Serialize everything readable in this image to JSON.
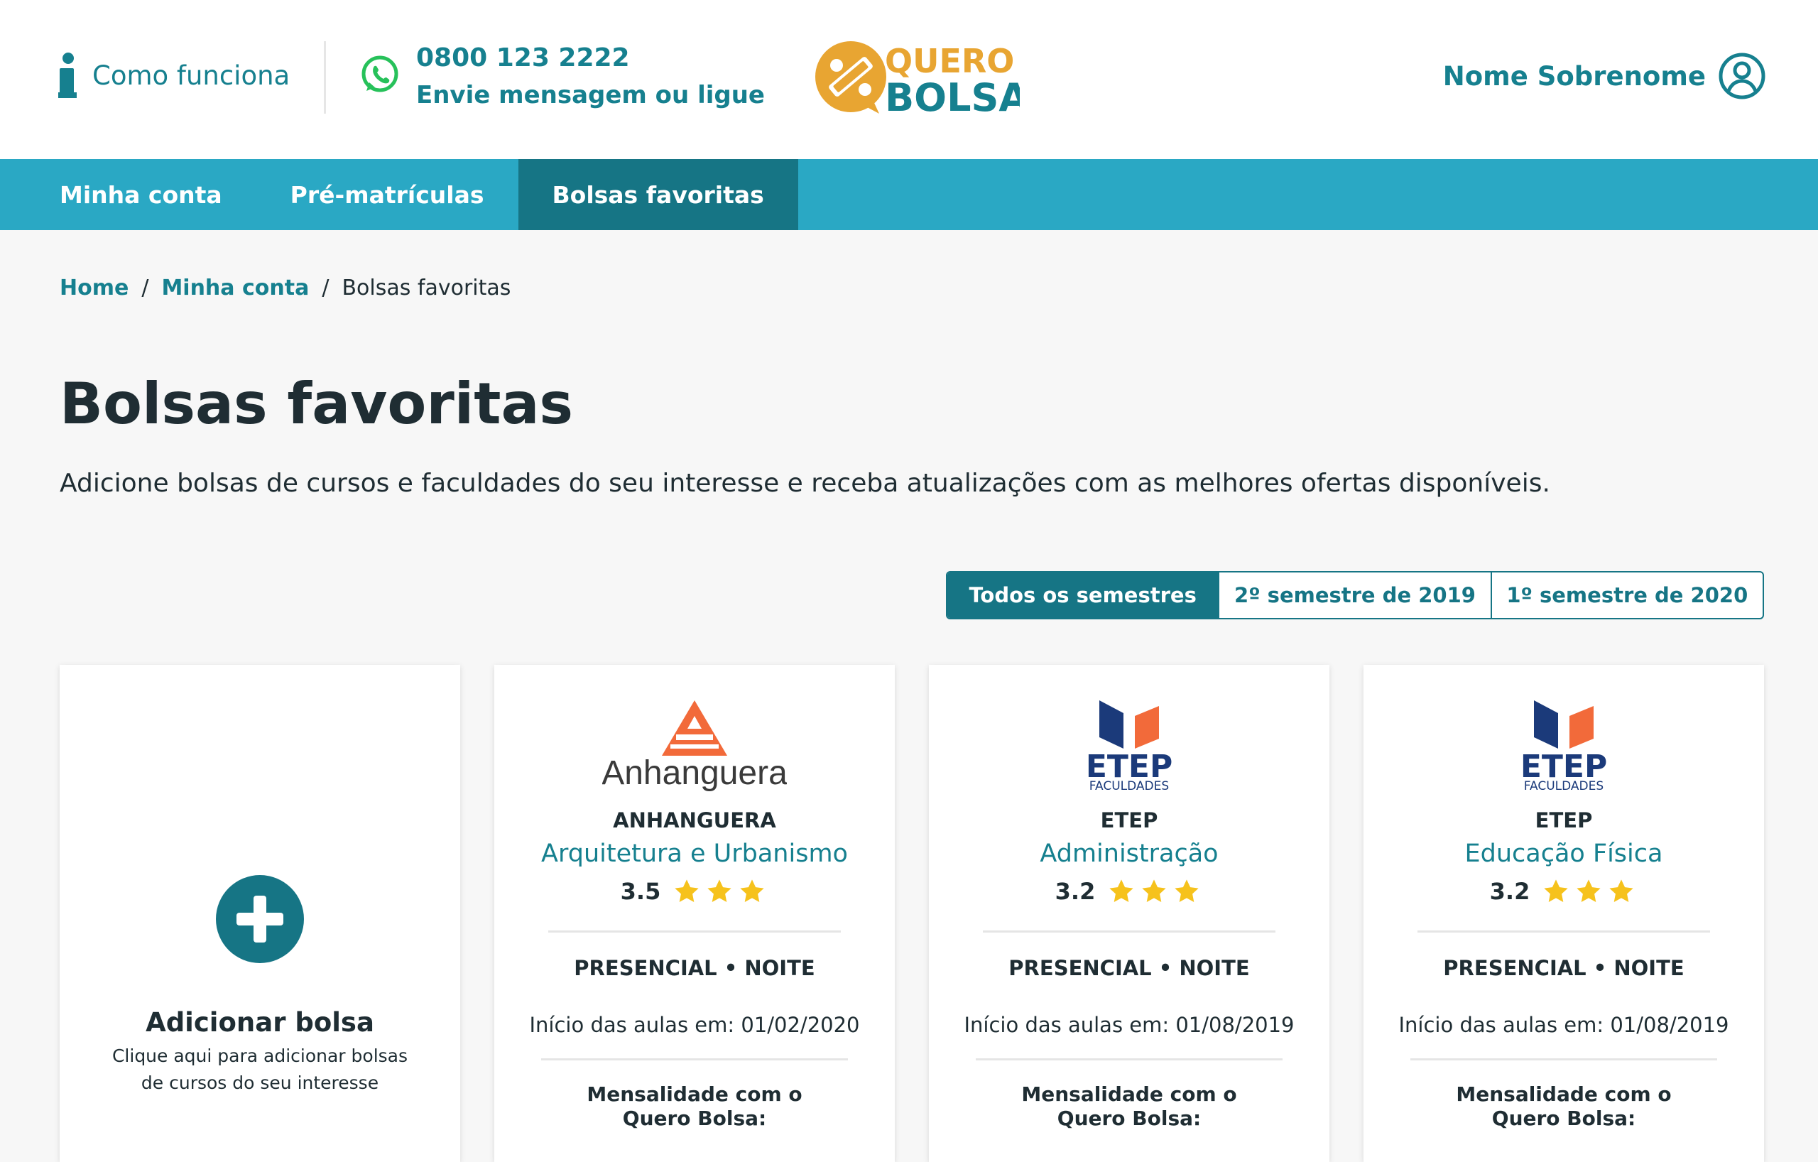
{
  "header": {
    "how_it_works": "Como funciona",
    "phone": "0800 123 2222",
    "phone_sub": "Envie mensagem ou ligue",
    "logo_line1": "QUERO",
    "logo_line2": "BOLSA",
    "user_name": "Nome Sobrenome"
  },
  "nav": {
    "tabs": [
      {
        "label": "Minha conta",
        "active": false
      },
      {
        "label": "Pré-matrículas",
        "active": false
      },
      {
        "label": "Bolsas favoritas",
        "active": true
      }
    ]
  },
  "breadcrumb": {
    "items": [
      "Home",
      "Minha conta",
      "Bolsas favoritas"
    ]
  },
  "page": {
    "title": "Bolsas favoritas",
    "subtitle": "Adicione bolsas de cursos e faculdades do seu interesse e receba atualizações com as melhores ofertas disponíveis."
  },
  "filters": {
    "options": [
      "Todos os semestres",
      "2º semestre de 2019",
      "1º semestre de 2020"
    ],
    "selected": "Todos os semestres"
  },
  "add_card": {
    "title": "Adicionar bolsa",
    "description": "Clique aqui para adicionar bolsas de cursos do seu interesse"
  },
  "offers": [
    {
      "logo_text": "Anhanguera",
      "university": "ANHANGUERA",
      "course": "Arquitetura e Urbanismo",
      "rating": "3.5",
      "stars": 3,
      "mode": "PRESENCIAL • NOITE",
      "start": "Início das aulas em: 01/02/2020",
      "price_label": "Mensalidade com o Quero Bolsa:"
    },
    {
      "logo_text": "ETEP",
      "logo_sub": "FACULDADES",
      "university": "ETEP",
      "course": "Administração",
      "rating": "3.2",
      "stars": 3,
      "mode": "PRESENCIAL • NOITE",
      "start": "Início das aulas em: 01/08/2019",
      "price_label": "Mensalidade com o Quero Bolsa:"
    },
    {
      "logo_text": "ETEP",
      "logo_sub": "FACULDADES",
      "university": "ETEP",
      "course": "Educação Física",
      "rating": "3.2",
      "stars": 3,
      "mode": "PRESENCIAL • NOITE",
      "start": "Início das aulas em: 01/08/2019",
      "price_label": "Mensalidade com o Quero Bolsa:"
    }
  ],
  "colors": {
    "primary": "#16808f",
    "nav": "#2aa8c4",
    "nav_active": "#167585",
    "logo_orange": "#e8a532",
    "star": "#f6c21c",
    "anhanguera_orange": "#f26a3a",
    "etep_blue": "#1b3a7a"
  }
}
